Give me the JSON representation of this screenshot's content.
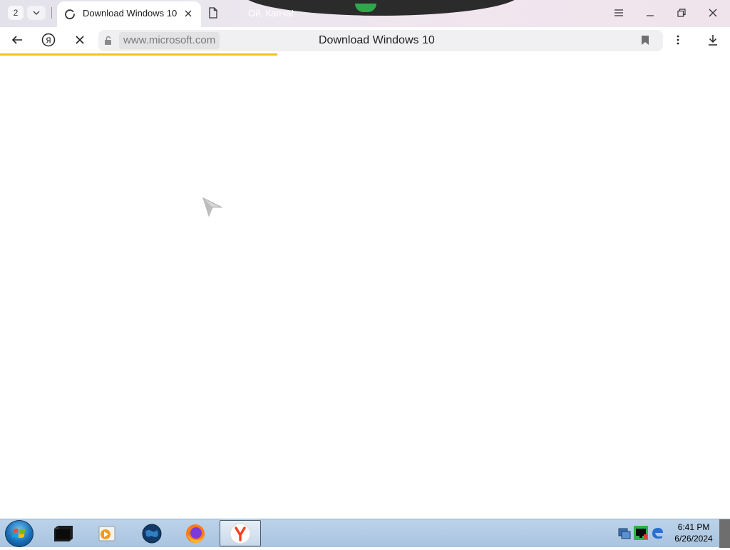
{
  "browser": {
    "tab_count": "2",
    "tabs": [
      {
        "title": "Download Windows 10",
        "state": "loading",
        "icon": "spinner-icon"
      },
      {
        "title": "Ой, Капча!",
        "icon": "document-icon"
      }
    ],
    "address": {
      "domain": "www.microsoft.com",
      "page_title": "Download Windows 10"
    },
    "load_progress": 0.38,
    "accent_color": "#f0c21c"
  },
  "taskbar": {
    "apps": [
      {
        "name": "terminal",
        "icon": "terminal-icon"
      },
      {
        "name": "media-player",
        "icon": "media-player-icon"
      },
      {
        "name": "globe",
        "icon": "globe-icon"
      },
      {
        "name": "firefox",
        "icon": "firefox-icon"
      },
      {
        "name": "yandex-browser",
        "icon": "yandex-browser-icon",
        "active": true
      }
    ],
    "tray_icons": [
      "network-icon",
      "display-icon",
      "edge-icon"
    ],
    "clock": {
      "time": "6:41 PM",
      "date": "6/26/2024"
    }
  }
}
